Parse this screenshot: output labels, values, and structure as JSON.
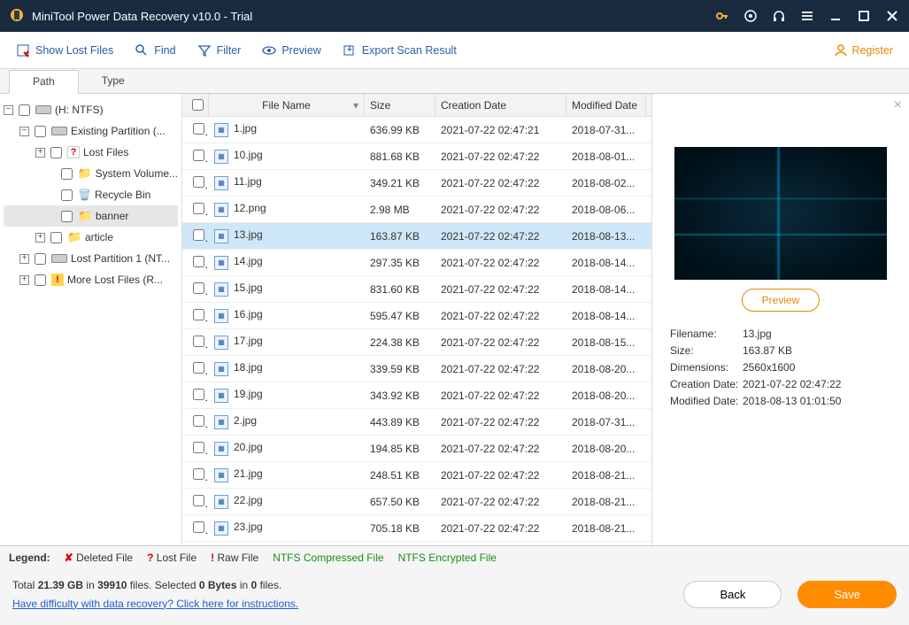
{
  "title": "MiniTool Power Data Recovery v10.0 - Trial",
  "toolbar": {
    "show_lost": "Show Lost Files",
    "find": "Find",
    "filter": "Filter",
    "preview": "Preview",
    "export": "Export Scan Result",
    "register": "Register"
  },
  "tabs": {
    "path": "Path",
    "type": "Type"
  },
  "tree": {
    "root": "(H: NTFS)",
    "existing": "Existing Partition (...",
    "lost_files": "Lost Files",
    "sysvol": "System Volume...",
    "recycle": "Recycle Bin",
    "banner": "banner",
    "article": "article",
    "lost_part": "Lost Partition 1 (NT...",
    "more_lost": "More Lost Files (R..."
  },
  "columns": {
    "name": "File Name",
    "size": "Size",
    "cdate": "Creation Date",
    "mdate": "Modified Date"
  },
  "files": [
    {
      "name": "1.jpg",
      "size": "636.99 KB",
      "cdate": "2021-07-22 02:47:21",
      "mdate": "2018-07-31..."
    },
    {
      "name": "10.jpg",
      "size": "881.68 KB",
      "cdate": "2021-07-22 02:47:22",
      "mdate": "2018-08-01..."
    },
    {
      "name": "11.jpg",
      "size": "349.21 KB",
      "cdate": "2021-07-22 02:47:22",
      "mdate": "2018-08-02..."
    },
    {
      "name": "12.png",
      "size": "2.98 MB",
      "cdate": "2021-07-22 02:47:22",
      "mdate": "2018-08-06..."
    },
    {
      "name": "13.jpg",
      "size": "163.87 KB",
      "cdate": "2021-07-22 02:47:22",
      "mdate": "2018-08-13...",
      "selected": true
    },
    {
      "name": "14.jpg",
      "size": "297.35 KB",
      "cdate": "2021-07-22 02:47:22",
      "mdate": "2018-08-14..."
    },
    {
      "name": "15.jpg",
      "size": "831.60 KB",
      "cdate": "2021-07-22 02:47:22",
      "mdate": "2018-08-14..."
    },
    {
      "name": "16.jpg",
      "size": "595.47 KB",
      "cdate": "2021-07-22 02:47:22",
      "mdate": "2018-08-14..."
    },
    {
      "name": "17.jpg",
      "size": "224.38 KB",
      "cdate": "2021-07-22 02:47:22",
      "mdate": "2018-08-15..."
    },
    {
      "name": "18.jpg",
      "size": "339.59 KB",
      "cdate": "2021-07-22 02:47:22",
      "mdate": "2018-08-20..."
    },
    {
      "name": "19.jpg",
      "size": "343.92 KB",
      "cdate": "2021-07-22 02:47:22",
      "mdate": "2018-08-20..."
    },
    {
      "name": "2.jpg",
      "size": "443.89 KB",
      "cdate": "2021-07-22 02:47:22",
      "mdate": "2018-07-31..."
    },
    {
      "name": "20.jpg",
      "size": "194.85 KB",
      "cdate": "2021-07-22 02:47:22",
      "mdate": "2018-08-20..."
    },
    {
      "name": "21.jpg",
      "size": "248.51 KB",
      "cdate": "2021-07-22 02:47:22",
      "mdate": "2018-08-21..."
    },
    {
      "name": "22.jpg",
      "size": "657.50 KB",
      "cdate": "2021-07-22 02:47:22",
      "mdate": "2018-08-21..."
    },
    {
      "name": "23.jpg",
      "size": "705.18 KB",
      "cdate": "2021-07-22 02:47:22",
      "mdate": "2018-08-21..."
    }
  ],
  "preview": {
    "btn": "Preview",
    "labels": {
      "fn": "Filename:",
      "sz": "Size:",
      "dim": "Dimensions:",
      "cd": "Creation Date:",
      "md": "Modified Date:"
    },
    "values": {
      "fn": "13.jpg",
      "sz": "163.87 KB",
      "dim": "2560x1600",
      "cd": "2021-07-22 02:47:22",
      "md": "2018-08-13 01:01:50"
    }
  },
  "legend": {
    "title": "Legend:",
    "deleted": "Deleted File",
    "lost": "Lost File",
    "raw": "Raw File",
    "compressed": "NTFS Compressed File",
    "encrypted": "NTFS Encrypted File"
  },
  "footer": {
    "summary_prefix": "Total ",
    "total_size": "21.39 GB",
    "in": " in ",
    "total_files": "39910",
    "files_label": " files.  Selected ",
    "sel_bytes": "0 Bytes",
    "in2": " in ",
    "sel_files": "0",
    "files_suffix": " files.",
    "help_link": "Have difficulty with data recovery? Click here for instructions.",
    "back": "Back",
    "save": "Save"
  }
}
